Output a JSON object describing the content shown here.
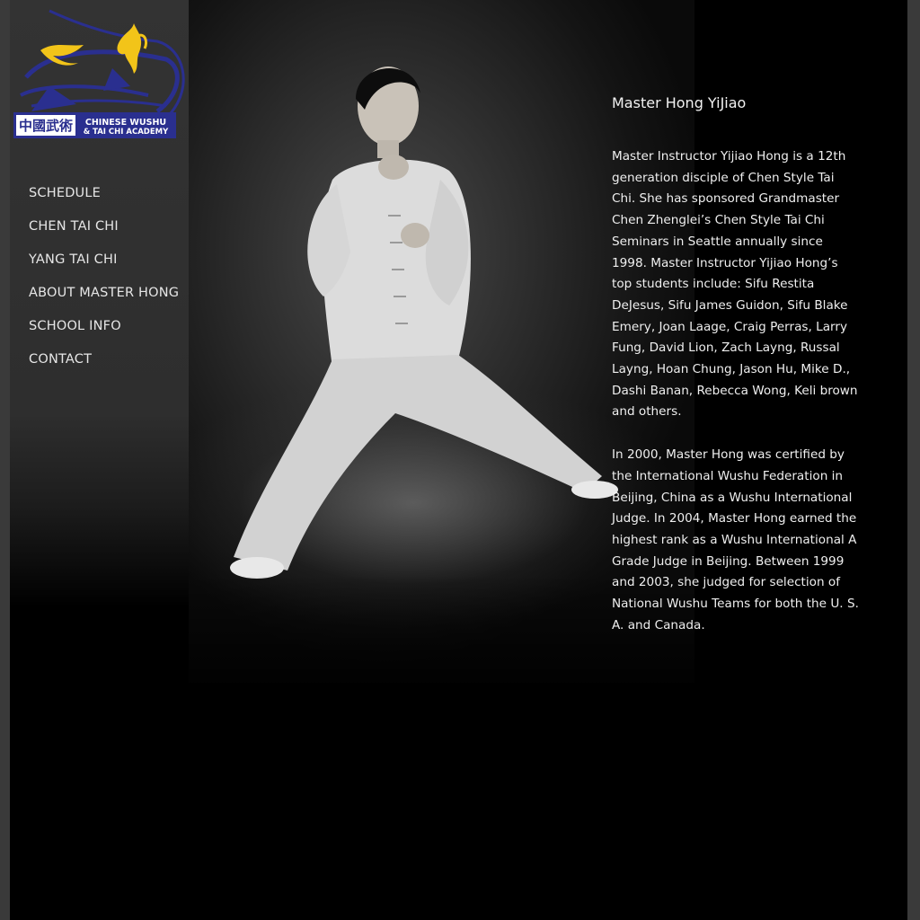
{
  "logo": {
    "chinese_text": "中國武術",
    "line1": "CHINESE WUSHU",
    "line2": "& TAI CHI ACADEMY"
  },
  "nav": {
    "items": [
      {
        "label": "SCHEDULE"
      },
      {
        "label": "CHEN TAI CHI"
      },
      {
        "label": "YANG TAI CHI"
      },
      {
        "label": "ABOUT MASTER HONG"
      },
      {
        "label": "SCHOOL INFO"
      },
      {
        "label": "CONTACT"
      }
    ]
  },
  "content": {
    "title": "Master Hong YiJiao",
    "paragraphs": [
      "Master Instructor Yijiao Hong is a 12th generation disciple of Chen Style Tai Chi. She has sponsored Grandmaster Chen Zhenglei’s Chen Style Tai Chi Seminars in Seattle annually since 1998. Master Instructor Yijiao Hong’s top students include: Sifu Restita DeJesus, Sifu James Guidon, Sifu Blake Emery, Joan Laage, Craig Perras, Larry Fung, David Lion, Zach Layng, Russal Layng, Hoan Chung, Jason Hu, Mike D., Dashi Banan, Rebecca Wong, Keli brown and others.",
      "In 2000, Master Hong was certified by the International Wushu Federation in Beijing, China as a Wushu International Judge. In 2004, Master Hong earned the highest rank as a Wushu International A Grade Judge in Beijing. Between 1999 and 2003, she judged for selection of National Wushu Teams for both the U. S. A. and Canada."
    ]
  },
  "colors": {
    "logo_blue": "#2a2f8f",
    "logo_yellow": "#f2c419",
    "sidebar": "#333333",
    "background": "#000000"
  }
}
